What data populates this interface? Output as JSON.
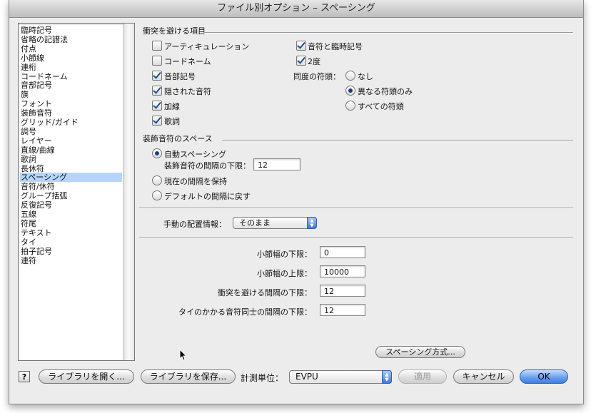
{
  "window": {
    "title": "ファイル別オプション – スペーシング"
  },
  "sidebar": {
    "items": [
      "臨時記号",
      "省略の記譜法",
      "付点",
      "小節線",
      "連桁",
      "コードネーム",
      "音部記号",
      "旗",
      "フォント",
      "装飾音符",
      "グリッド/ガイド",
      "調号",
      "レイヤー",
      "直線/曲線",
      "歌詞",
      "長休符",
      "スペーシング",
      "音符/休符",
      "グループ括弧",
      "反復記号",
      "五線",
      "符尾",
      "テキスト",
      "タイ",
      "拍子記号",
      "連符"
    ],
    "selected": "スペーシング"
  },
  "collision": {
    "header": "衝突を避ける項目",
    "articulation": "アーティキュレーション",
    "chord": "コードネーム",
    "clef": "音部記号",
    "hidden": "隠された音符",
    "ledger": "加線",
    "lyrics": "歌詞",
    "notes_acc": "音符と臨時記号",
    "second": "2度",
    "unison_label": "同度の符頭：",
    "unison_none": "なし",
    "unison_diff": "異なる符頭のみ",
    "unison_all": "すべての符頭"
  },
  "grace": {
    "header": "装飾音符のスペース",
    "auto": "自動スペーシング",
    "min_label": "装飾音符の間隔の下限：",
    "min_value": "12",
    "keep": "現在の間隔を保持",
    "default": "デフォルトの間隔に戻す"
  },
  "manual": {
    "label": "手動の配置情報：",
    "value": "そのまま"
  },
  "measures": {
    "min_width_label": "小節幅の下限：",
    "min_width": "0",
    "max_width_label": "小節幅の上限：",
    "max_width": "10000",
    "collision_min_label": "衝突を避ける間隔の下限：",
    "collision_min": "12",
    "tie_min_label": "タイのかかる音符同士の間隔の下限：",
    "tie_min": "12"
  },
  "buttons": {
    "spacing_method": "スペーシング方式...",
    "help": "?",
    "open_library": "ライブラリを開く...",
    "save_library": "ライブラリを保存...",
    "unit_label": "計測単位：",
    "unit_value": "EVPU",
    "apply": "適用",
    "cancel": "キャンセル",
    "ok": "OK"
  }
}
